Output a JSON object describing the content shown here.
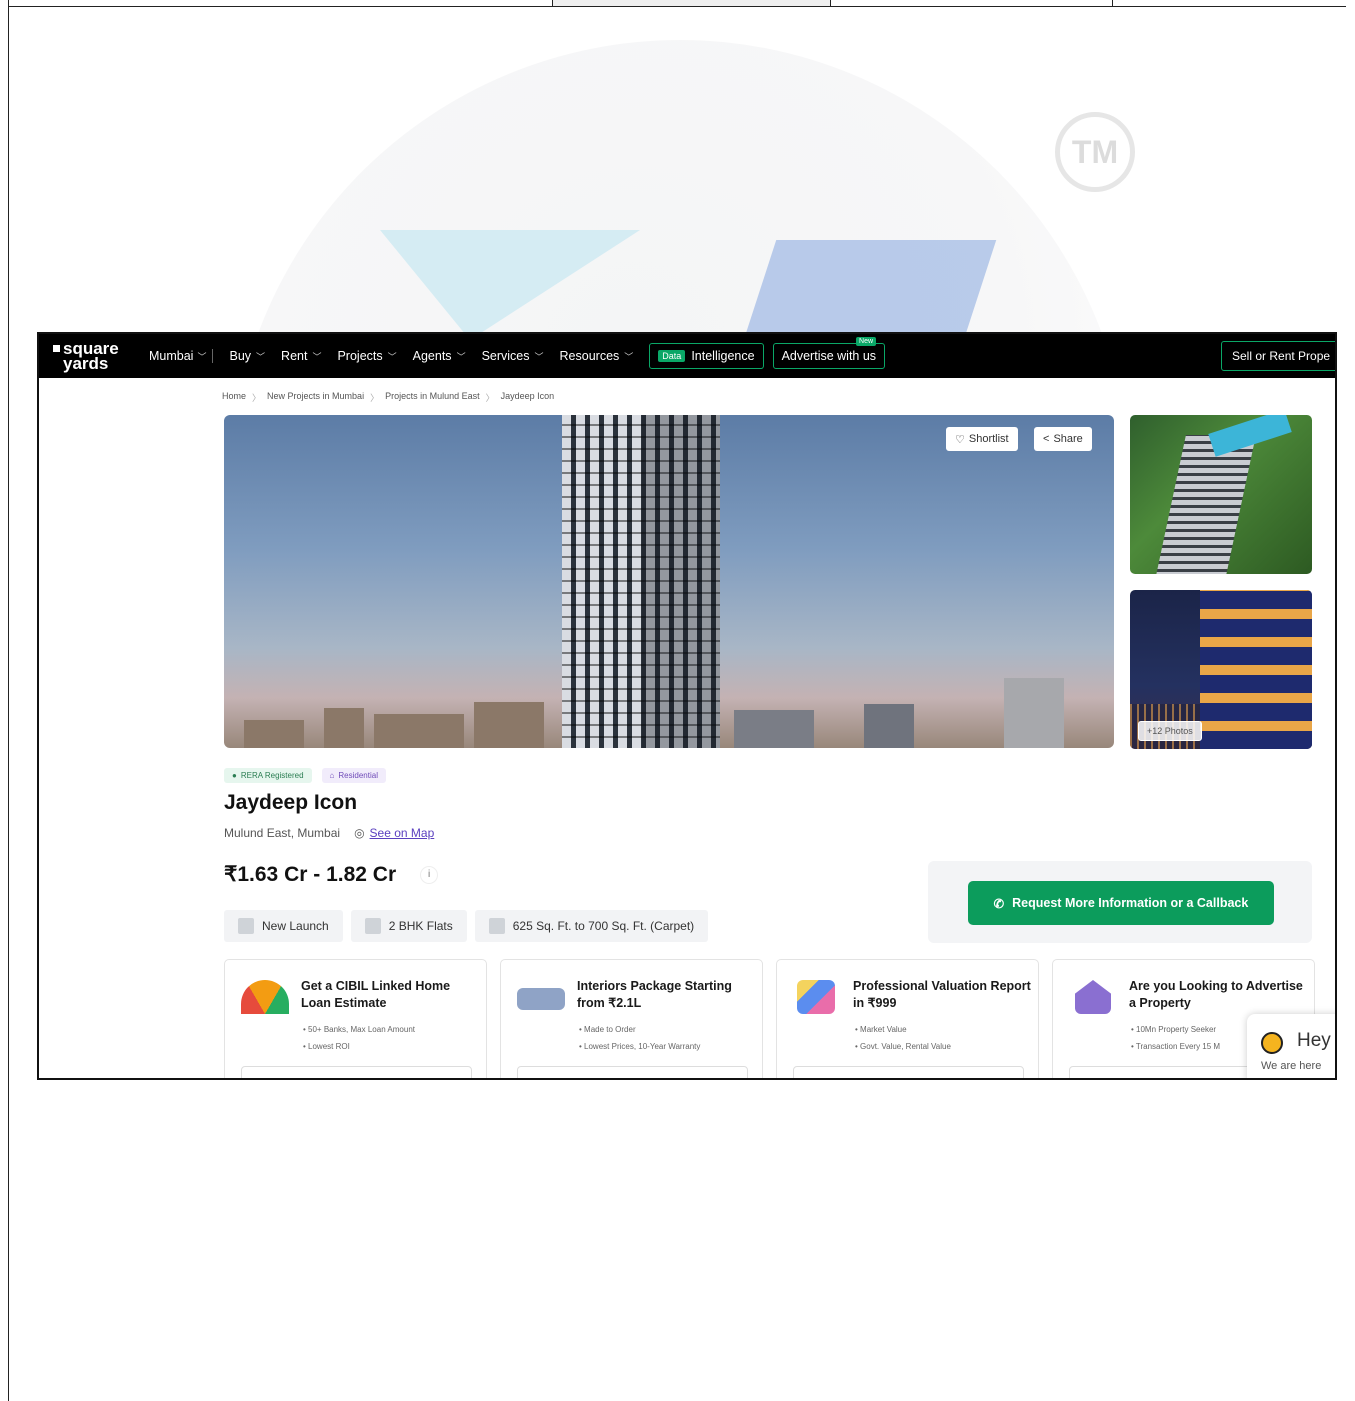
{
  "watermark": {
    "tm": "TM"
  },
  "nav": {
    "logo_line1": "square",
    "logo_line2": "yards",
    "city": "Mumbai",
    "items": [
      "Buy",
      "Rent",
      "Projects",
      "Agents",
      "Services",
      "Resources"
    ],
    "data_chip": "Data",
    "intelligence": "Intelligence",
    "advertise": "Advertise with us",
    "new_chip": "New",
    "sell": "Sell or Rent Prope"
  },
  "breadcrumb": [
    "Home",
    "New Projects in Mumbai",
    "Projects in Mulund East",
    "Jaydeep Icon"
  ],
  "hero": {
    "shortlist": "Shortlist",
    "share": "Share",
    "photos": "+12 Photos"
  },
  "badges": {
    "rera": "RERA Registered",
    "residential": "Residential"
  },
  "project": {
    "title": "Jaydeep Icon",
    "location": "Mulund East, Mumbai",
    "map_link": "See on Map",
    "price": "₹1.63 Cr - 1.82 Cr",
    "info": "i"
  },
  "chips": [
    "New Launch",
    "2 BHK Flats",
    "625 Sq. Ft. to 700 Sq. Ft. (Carpet)"
  ],
  "cta": {
    "label": "Request More Information or a Callback"
  },
  "cards": [
    {
      "title": "Get a CIBIL Linked Home Loan Estimate",
      "bullets": [
        "50+ Banks, Max Loan Amount",
        "Lowest ROI"
      ]
    },
    {
      "title": "Interiors Package Starting from ₹2.1L",
      "bullets": [
        "Made to Order",
        "Lowest Prices, 10-Year Warranty"
      ]
    },
    {
      "title": "Professional Valuation Report in ₹999",
      "bullets": [
        "Market Value",
        "Govt. Value, Rental Value"
      ]
    },
    {
      "title": "Are you Looking to Advertise a Property",
      "bullets": [
        "10Mn Property Seeker",
        "Transaction Every 15 M"
      ]
    }
  ],
  "chat": {
    "hey": "Hey",
    "sub": "We are here"
  },
  "colors": {
    "accent": "#0c9c5c",
    "nav_bg": "#000000",
    "link": "#5a3fbf"
  }
}
